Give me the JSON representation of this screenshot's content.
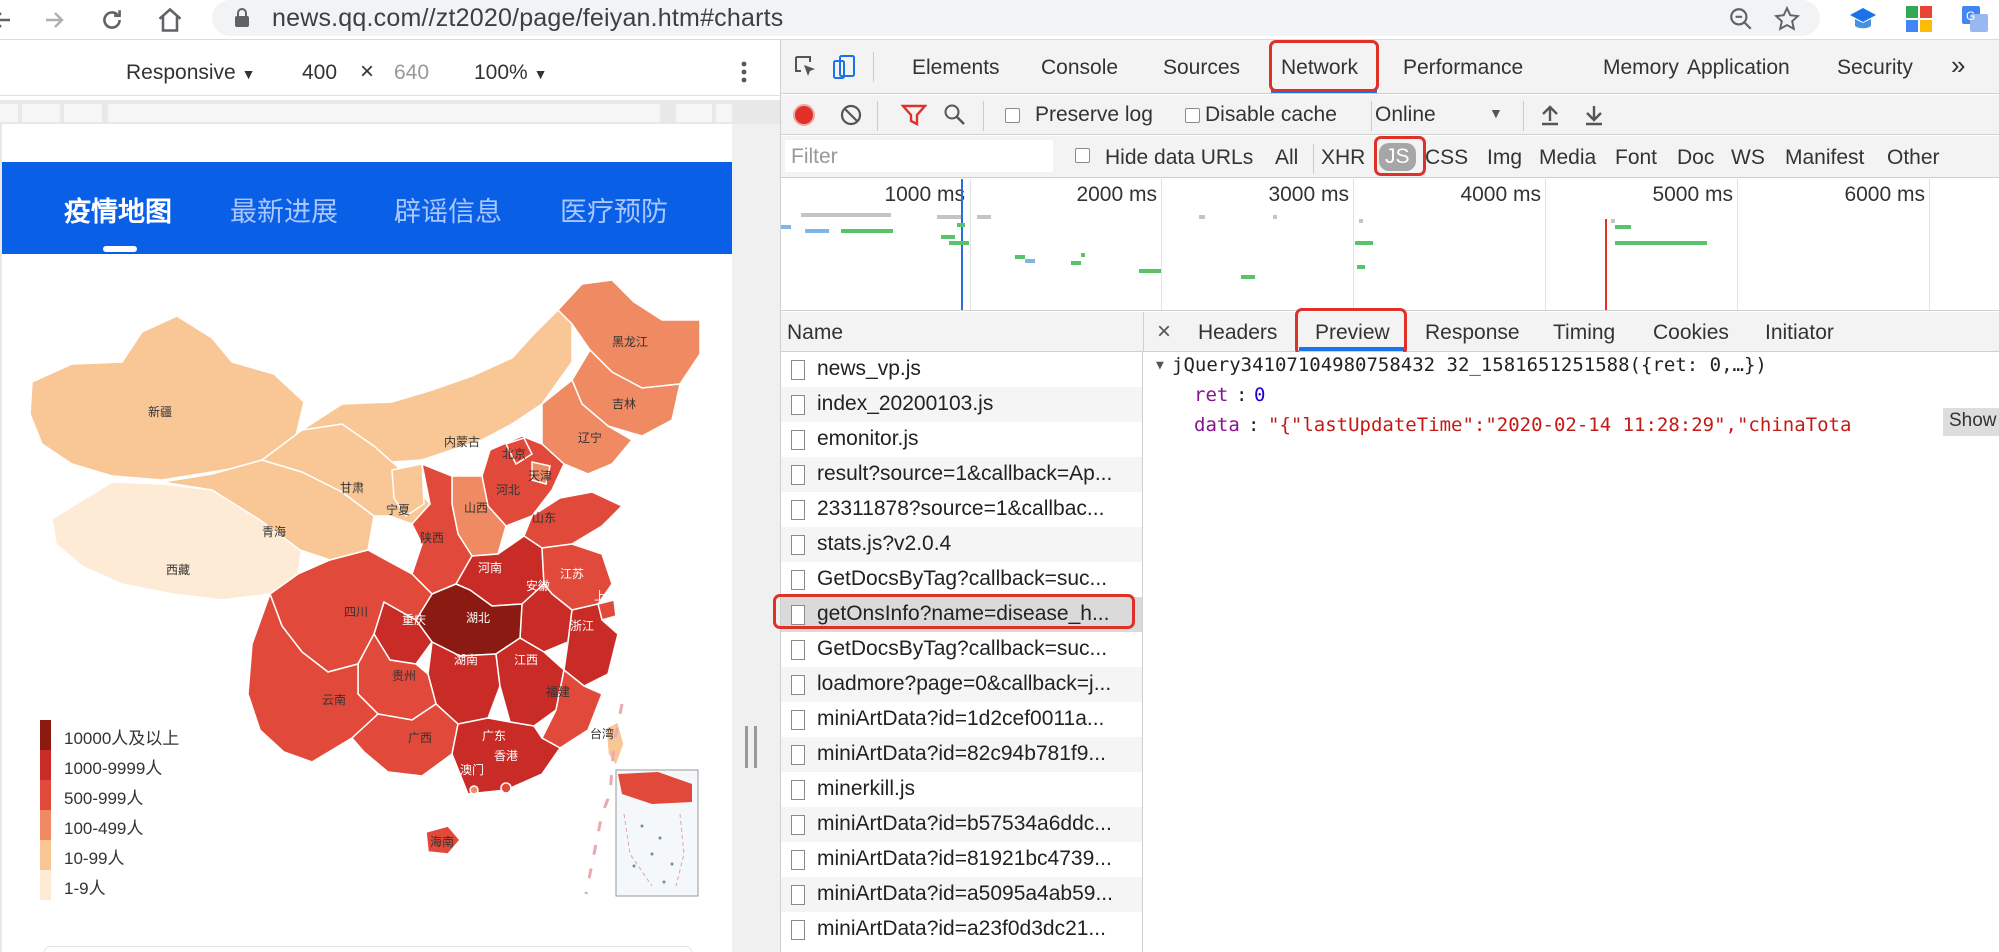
{
  "browser": {
    "url": "news.qq.com//zt2020/page/feiyan.htm#charts"
  },
  "device_toolbar": {
    "device": "Responsive",
    "width": "400",
    "times": "×",
    "height": "640",
    "zoom": "100%"
  },
  "page": {
    "tabs": [
      "疫情地图",
      "最新进展",
      "辟谣信息",
      "医疗预防"
    ],
    "map": {
      "provinces": [
        "黑龙江",
        "吉林",
        "辽宁",
        "内蒙古",
        "新疆",
        "北京",
        "天津",
        "河北",
        "甘肃",
        "宁夏",
        "山西",
        "山东",
        "青海",
        "陕西",
        "西藏",
        "河南",
        "江苏",
        "湖北",
        "安徽",
        "上海",
        "四川",
        "重庆",
        "浙江",
        "湖南",
        "江西",
        "贵州",
        "福建",
        "云南",
        "广西",
        "广东",
        "台湾",
        "澳门",
        "香港",
        "海南"
      ]
    },
    "legend": [
      {
        "label": "10000人及以上",
        "color": "#8b1a12"
      },
      {
        "label": "1000-9999人",
        "color": "#c92b26"
      },
      {
        "label": "500-999人",
        "color": "#e14a3a"
      },
      {
        "label": "100-499人",
        "color": "#ef8a62"
      },
      {
        "label": "10-99人",
        "color": "#f9c796"
      },
      {
        "label": "1-9人",
        "color": "#fdebd5"
      }
    ]
  },
  "devtools": {
    "tabs": [
      "Elements",
      "Console",
      "Sources",
      "Network",
      "Performance",
      "Memory",
      "Application",
      "Security",
      "»"
    ],
    "active_tab": "Network",
    "toolbar": {
      "preserve_log": "Preserve log",
      "disable_cache": "Disable cache",
      "throttle": "Online"
    },
    "filter": {
      "placeholder": "Filter",
      "hide_data_urls": "Hide data URLs",
      "types": [
        "All",
        "XHR",
        "JS",
        "CSS",
        "Img",
        "Media",
        "Font",
        "Doc",
        "WS",
        "Manifest",
        "Other"
      ],
      "selected_type": "JS"
    },
    "timeline_labels": [
      "1000 ms",
      "2000 ms",
      "3000 ms",
      "4000 ms",
      "5000 ms",
      "6000 ms"
    ],
    "requests_header": "Name",
    "requests": [
      "news_vp.js",
      "index_20200103.js",
      "emonitor.js",
      "result?source=1&callback=Ap...",
      "23311878?source=1&callbac...",
      "stats.js?v2.0.4",
      "GetDocsByTag?callback=suc...",
      "getOnsInfo?name=disease_h...",
      "GetDocsByTag?callback=suc...",
      "loadmore?page=0&callback=j...",
      "miniArtData?id=1d2cef0011a...",
      "miniArtData?id=82c94b781f9...",
      "minerkill.js",
      "miniArtData?id=b57534a6ddc...",
      "miniArtData?id=81921bc4739...",
      "miniArtData?id=a5095a4ab59...",
      "miniArtData?id=a23f0d3dc21..."
    ],
    "selected_request": "getOnsInfo?name=disease_h...",
    "detail_close": "×",
    "detail_tabs": [
      "Headers",
      "Preview",
      "Response",
      "Timing",
      "Cookies",
      "Initiator"
    ],
    "active_detail_tab": "Preview",
    "preview": {
      "root": "jQuery34107104980758432 32_1581651251588({ret: 0,…})",
      "ret_key": "ret",
      "ret_val": "0",
      "data_key": "data",
      "data_val": "\"{\"lastUpdateTime\":\"2020-02-14 11:28:29\",\"chinaTota",
      "show_more": "Show"
    }
  }
}
